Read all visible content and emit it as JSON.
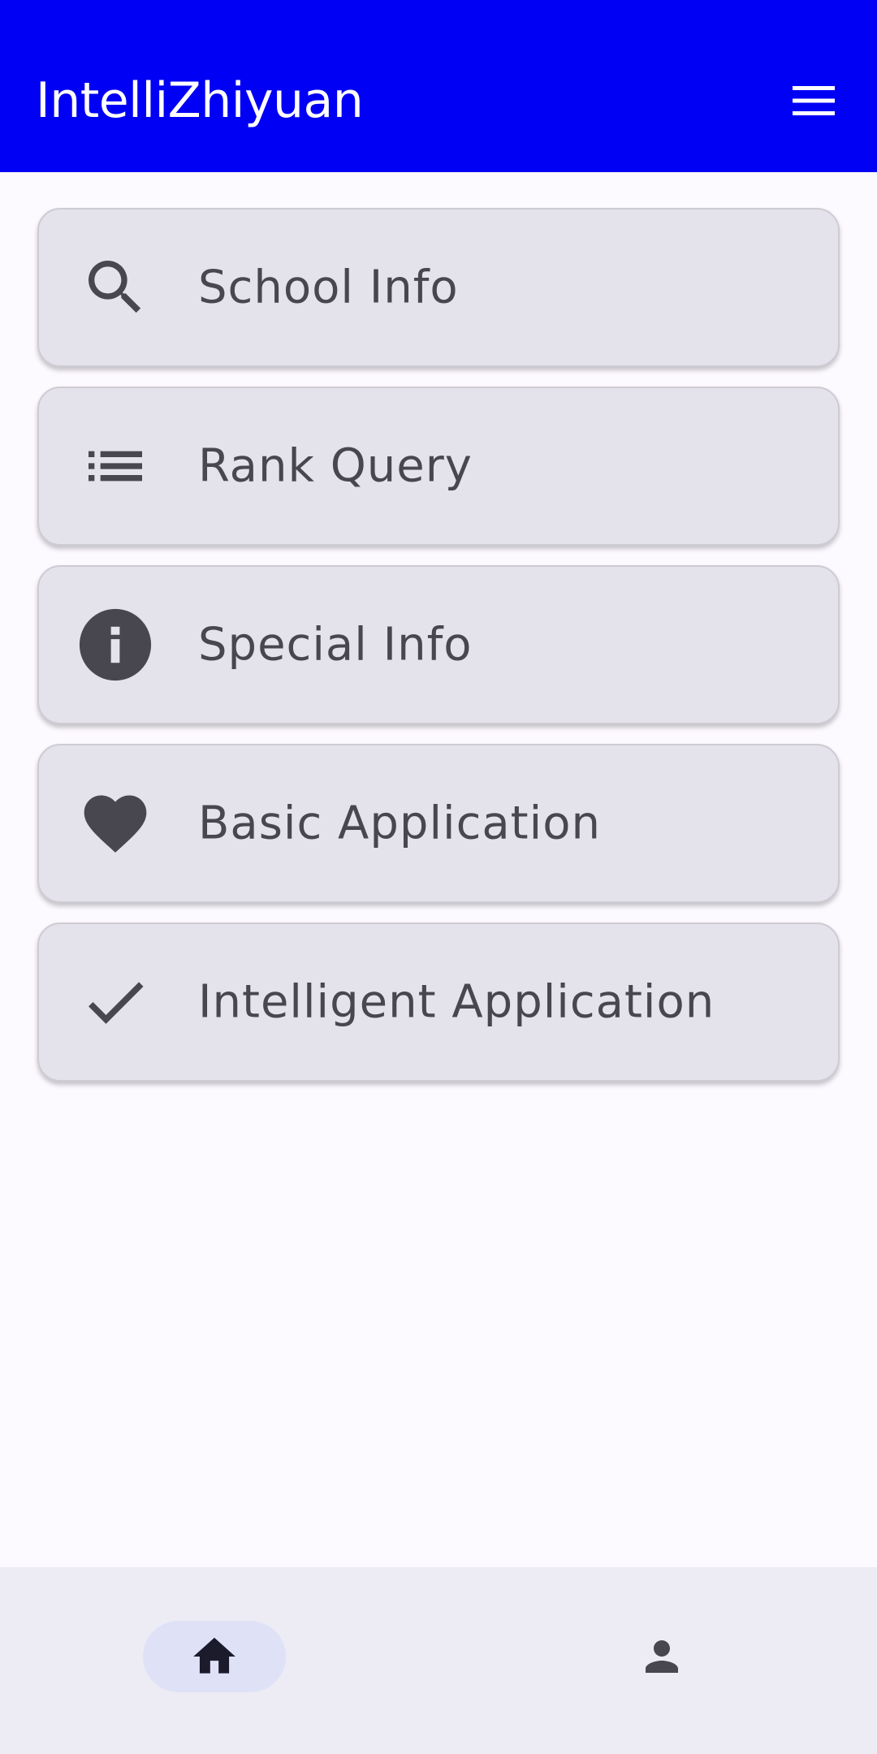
{
  "app_bar": {
    "title": "IntelliZhiyuan",
    "menu_icon": "hamburger-menu-icon",
    "background_color": "#0000f5"
  },
  "menu": {
    "items": [
      {
        "label": "School Info",
        "icon": "search-icon"
      },
      {
        "label": "Rank Query",
        "icon": "list-icon"
      },
      {
        "label": "Special Info",
        "icon": "info-icon"
      },
      {
        "label": "Basic Application",
        "icon": "heart-icon"
      },
      {
        "label": "Intelligent Application",
        "icon": "check-icon"
      }
    ],
    "card_color": "#e4e2eb",
    "text_color": "#48464f"
  },
  "bottom_nav": {
    "items": [
      {
        "icon": "home-icon",
        "selected": true
      },
      {
        "icon": "person-icon",
        "selected": false
      }
    ],
    "indicator_color": "#dfe2f7"
  }
}
